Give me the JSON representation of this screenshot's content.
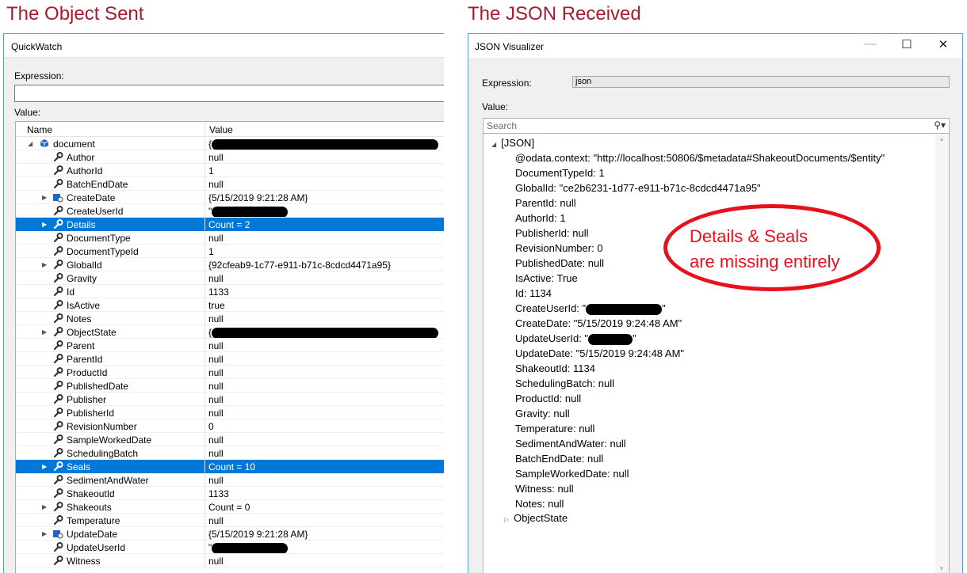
{
  "headings": {
    "left": "The Object Sent",
    "right": "The JSON Received"
  },
  "quickwatch": {
    "title": "QuickWatch",
    "expression_label": "Expression:",
    "expression_value": "",
    "value_label": "Value:",
    "columns": {
      "name": "Name",
      "value": "Value"
    },
    "root": {
      "name": "document",
      "value": "{"
    },
    "rows": [
      {
        "name": "Author",
        "value": "null"
      },
      {
        "name": "AuthorId",
        "value": "1"
      },
      {
        "name": "BatchEndDate",
        "value": "null"
      },
      {
        "name": "CreateDate",
        "value": "{5/15/2019 9:21:28 AM}"
      },
      {
        "name": "CreateUserId",
        "value": "\""
      },
      {
        "name": "Details",
        "value": "Count = 2"
      },
      {
        "name": "DocumentType",
        "value": "null"
      },
      {
        "name": "DocumentTypeId",
        "value": "1"
      },
      {
        "name": "GlobalId",
        "value": "{92cfeab9-1c77-e911-b71c-8cdcd4471a95}"
      },
      {
        "name": "Gravity",
        "value": "null"
      },
      {
        "name": "Id",
        "value": "1133"
      },
      {
        "name": "IsActive",
        "value": "true"
      },
      {
        "name": "Notes",
        "value": "null"
      },
      {
        "name": "ObjectState",
        "value": "{"
      },
      {
        "name": "Parent",
        "value": "null"
      },
      {
        "name": "ParentId",
        "value": "null"
      },
      {
        "name": "ProductId",
        "value": "null"
      },
      {
        "name": "PublishedDate",
        "value": "null"
      },
      {
        "name": "Publisher",
        "value": "null"
      },
      {
        "name": "PublisherId",
        "value": "null"
      },
      {
        "name": "RevisionNumber",
        "value": "0"
      },
      {
        "name": "SampleWorkedDate",
        "value": "null"
      },
      {
        "name": "SchedulingBatch",
        "value": "null"
      },
      {
        "name": "Seals",
        "value": "Count = 10"
      },
      {
        "name": "SedimentAndWater",
        "value": "null"
      },
      {
        "name": "ShakeoutId",
        "value": "1133"
      },
      {
        "name": "Shakeouts",
        "value": "Count = 0"
      },
      {
        "name": "Temperature",
        "value": "null"
      },
      {
        "name": "UpdateDate",
        "value": "{5/15/2019 9:21:28 AM}"
      },
      {
        "name": "UpdateUserId",
        "value": "\""
      },
      {
        "name": "Witness",
        "value": "null"
      }
    ]
  },
  "json_visualizer": {
    "title": "JSON Visualizer",
    "expression_label": "Expression:",
    "expression_value": "json",
    "value_label": "Value:",
    "search_placeholder": "Search",
    "root_label": "[JSON]",
    "lines": [
      "@odata.context: \"http://localhost:50806/$metadata#ShakeoutDocuments/$entity\"",
      "DocumentTypeId: 1",
      "GlobalId: \"ce2b6231-1d77-e911-b71c-8cdcd4471a95\"",
      "ParentId: null",
      "AuthorId: 1",
      "PublisherId: null",
      "RevisionNumber: 0",
      "PublishedDate: null",
      "IsActive: True",
      "Id: 1134",
      "CreateUserId: \"",
      "CreateDate: \"5/15/2019 9:24:48 AM\"",
      "UpdateUserId: \"",
      "UpdateDate: \"5/15/2019 9:24:48 AM\"",
      "ShakeoutId: 1134",
      "SchedulingBatch: null",
      "ProductId: null",
      "Gravity: null",
      "Temperature: null",
      "SedimentAndWater: null",
      "BatchEndDate: null",
      "SampleWorkedDate: null",
      "Witness: null",
      "Notes: null"
    ],
    "last_node": "ObjectState"
  },
  "callout": {
    "line1": "Details & Seals",
    "line2": "are missing entirely"
  },
  "colors": {
    "heading": "#a51c30",
    "selection": "#0078d7",
    "callout": "#e8101c"
  }
}
